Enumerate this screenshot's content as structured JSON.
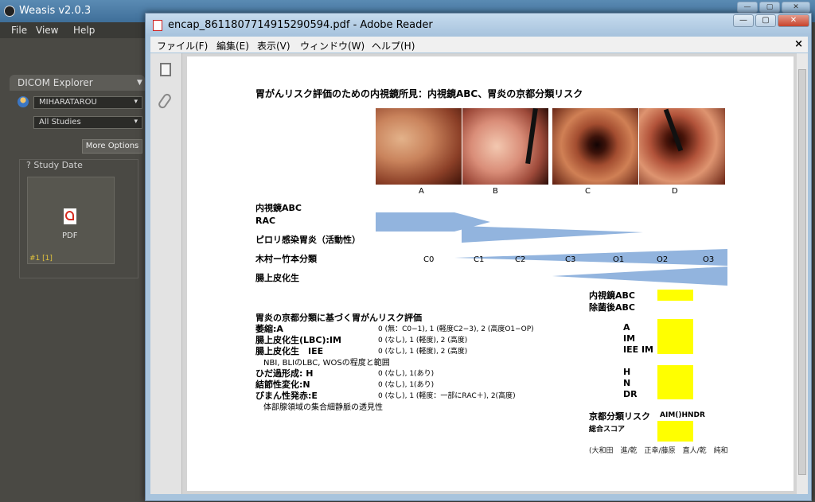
{
  "weasis": {
    "title": "Weasis v2.0.3",
    "menu": [
      "File",
      "View",
      "Help"
    ],
    "explorer_tab": "DICOM Explorer",
    "patient": "MIHARATAROU",
    "studies_filter": "All Studies",
    "more_options": "More Options",
    "study_date_label": "? Study Date",
    "thumb_label": "PDF",
    "thumb_tag": "#1 [1]",
    "controls": [
      "—",
      "▢",
      "✕"
    ],
    "accent": "#4f82ad"
  },
  "reader": {
    "title": "encap_8611807714915290594.pdf - Adobe Reader",
    "menu": [
      "ファイル(F)",
      "編集(E)",
      "表示(V)",
      "ウィンドウ(W)",
      "ヘルプ(H)"
    ],
    "close_doc": "×",
    "controls": [
      "—",
      "▢",
      "✕"
    ],
    "nav_icons": [
      "pages-icon",
      "attachment-icon"
    ]
  },
  "pdf": {
    "title": "胃がんリスク評価のための内視鏡所見：内視鏡ABC、胃炎の京都分類リスク",
    "image_labels": [
      "A",
      "B",
      "C",
      "D"
    ],
    "rows": {
      "endoscopy_abc": "内視鏡ABC",
      "rac": "RAC",
      "pylori": "ピロリ感染胃炎（活動性）",
      "kimura": "木村ー竹本分類",
      "im": "腸上皮化生"
    },
    "grades": [
      "C0",
      "C1",
      "C2",
      "C3",
      "O1",
      "O2",
      "O3"
    ],
    "right_labels": {
      "endoscopy_abc": "内視鏡ABC",
      "post_eradication": "除菌後ABC"
    },
    "risk_section_title": "胃炎の京都分類に基づく胃がんリスク評価",
    "risk_items": [
      {
        "name": "萎縮:A",
        "desc": "0 (無：C0−1), 1 (軽度C2−3), 2 (高度O1−OP)",
        "code": "A"
      },
      {
        "name": "腸上皮化生(LBC):IM",
        "desc": "0 (なし), 1 (軽度), 2 (高度)",
        "code": "IM"
      },
      {
        "name": "腸上皮化生　IEE",
        "desc": "0 (なし), 1 (軽度), 2 (高度)",
        "code": "IEE IM"
      },
      {
        "name": "ひだ過形成: H",
        "desc": "0 (なし), 1(あり)",
        "code": "H"
      },
      {
        "name": "結節性変化:N",
        "desc": "0 (なし), 1(あり)",
        "code": "N"
      },
      {
        "name": "びまん性発赤:E",
        "desc": "0 (なし), 1 (軽度：一部にRAC＋), 2(高度)",
        "code": "DR"
      }
    ],
    "iee_note": "NBI, BLIのLBC, WOSの程度と範囲",
    "vein_note": "体部腺領域の集合細静脈の透見性",
    "kyoto_risk_label": "京都分類リスク",
    "kyoto_risk_code": "AIM()HNDR",
    "total_score_label": "総合スコア",
    "authors": "(大和田　進/乾　正幸/藤原　直人/乾　純和",
    "colors": {
      "wedge": "#92b4de",
      "highlight": "#ffff00"
    }
  }
}
